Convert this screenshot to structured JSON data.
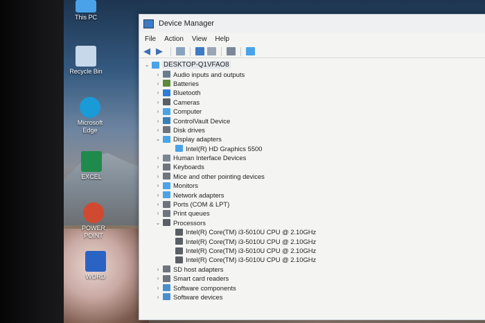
{
  "desktop": {
    "icons": [
      {
        "label": "This PC",
        "color": "#4aa3e8"
      },
      {
        "label": "Recycle Bin",
        "color": "#c7d8ea"
      },
      {
        "label": "Microsoft Edge",
        "color": "#1b9ad8"
      },
      {
        "label": "EXCEL",
        "color": "#1f8a4c"
      },
      {
        "label": "POWER POINT",
        "color": "#d04a31"
      },
      {
        "label": "WORD",
        "color": "#2b63c4"
      }
    ]
  },
  "window": {
    "title": "Device Manager",
    "menu": [
      "File",
      "Action",
      "View",
      "Help"
    ],
    "tree": {
      "root": "DESKTOP-Q1VFAO8",
      "items": [
        {
          "label": "Audio inputs and outputs",
          "expanded": false,
          "icon": "speaker-icon",
          "color": "#6a7b8e"
        },
        {
          "label": "Batteries",
          "expanded": false,
          "icon": "battery-icon",
          "color": "#5d8a3a"
        },
        {
          "label": "Bluetooth",
          "expanded": false,
          "icon": "bluetooth-icon",
          "color": "#2f7bd8"
        },
        {
          "label": "Cameras",
          "expanded": false,
          "icon": "camera-icon",
          "color": "#5a5f66"
        },
        {
          "label": "Computer",
          "expanded": false,
          "icon": "computer-icon",
          "color": "#4aa3e8"
        },
        {
          "label": "ControlVault Device",
          "expanded": false,
          "icon": "controlvault-icon",
          "color": "#3a7fb8"
        },
        {
          "label": "Disk drives",
          "expanded": false,
          "icon": "disk-drive-icon",
          "color": "#6f757c"
        },
        {
          "label": "Display adapters",
          "expanded": true,
          "icon": "display-adapter-icon",
          "color": "#4aa3e8",
          "children": [
            {
              "label": "Intel(R) HD Graphics 5500",
              "icon": "display-adapter-icon",
              "color": "#4aa3e8"
            }
          ]
        },
        {
          "label": "Human Interface Devices",
          "expanded": false,
          "icon": "hid-icon",
          "color": "#7b8694"
        },
        {
          "label": "Keyboards",
          "expanded": false,
          "icon": "keyboard-icon",
          "color": "#6f757c"
        },
        {
          "label": "Mice and other pointing devices",
          "expanded": false,
          "icon": "mouse-icon",
          "color": "#6f757c"
        },
        {
          "label": "Monitors",
          "expanded": false,
          "icon": "monitor-icon",
          "color": "#4aa3e8"
        },
        {
          "label": "Network adapters",
          "expanded": false,
          "icon": "network-icon",
          "color": "#4aa3e8"
        },
        {
          "label": "Ports (COM & LPT)",
          "expanded": false,
          "icon": "port-icon",
          "color": "#6f757c"
        },
        {
          "label": "Print queues",
          "expanded": false,
          "icon": "printer-icon",
          "color": "#6f757c"
        },
        {
          "label": "Processors",
          "expanded": true,
          "icon": "processor-icon",
          "color": "#5a5f66",
          "children": [
            {
              "label": "Intel(R) Core(TM) i3-5010U CPU @ 2.10GHz",
              "icon": "processor-icon",
              "color": "#5a5f66"
            },
            {
              "label": "Intel(R) Core(TM) i3-5010U CPU @ 2.10GHz",
              "icon": "processor-icon",
              "color": "#5a5f66"
            },
            {
              "label": "Intel(R) Core(TM) i3-5010U CPU @ 2.10GHz",
              "icon": "processor-icon",
              "color": "#5a5f66"
            },
            {
              "label": "Intel(R) Core(TM) i3-5010U CPU @ 2.10GHz",
              "icon": "processor-icon",
              "color": "#5a5f66"
            }
          ]
        },
        {
          "label": "SD host adapters",
          "expanded": false,
          "icon": "sd-icon",
          "color": "#6f757c"
        },
        {
          "label": "Smart card readers",
          "expanded": false,
          "icon": "smart-card-icon",
          "color": "#6f757c"
        },
        {
          "label": "Software components",
          "expanded": false,
          "icon": "software-component-icon",
          "color": "#4a8fd0"
        },
        {
          "label": "Software devices",
          "expanded": false,
          "icon": "software-device-icon",
          "color": "#4a8fd0"
        }
      ]
    }
  }
}
